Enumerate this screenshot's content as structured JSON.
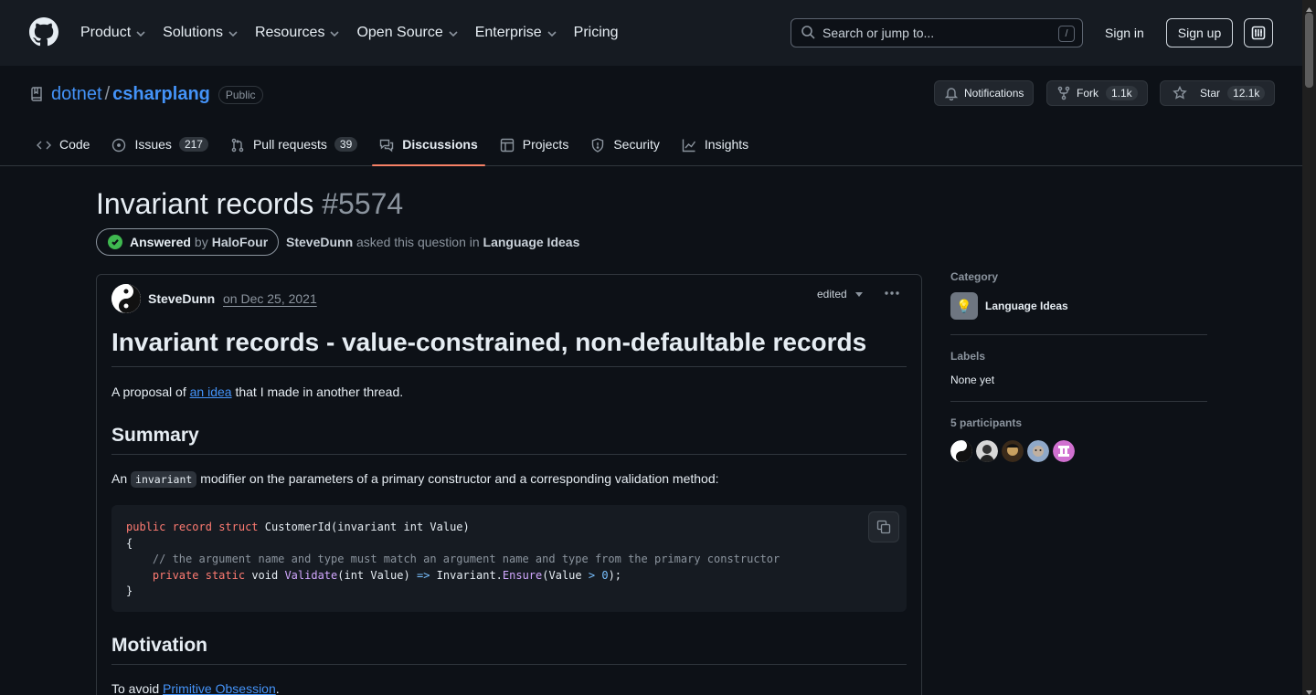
{
  "header": {
    "nav": [
      "Product",
      "Solutions",
      "Resources",
      "Open Source",
      "Enterprise",
      "Pricing"
    ],
    "search_placeholder": "Search or jump to...",
    "search_shortcut": "/",
    "sign_in": "Sign in",
    "sign_up": "Sign up"
  },
  "repo": {
    "owner": "dotnet",
    "separator": "/",
    "name": "csharplang",
    "visibility": "Public",
    "notifications": "Notifications",
    "fork_label": "Fork",
    "fork_count": "1.1k",
    "star_label": "Star",
    "star_count": "12.1k"
  },
  "tabs": [
    {
      "label": "Code",
      "icon": "code-icon"
    },
    {
      "label": "Issues",
      "count": "217",
      "icon": "issue-icon"
    },
    {
      "label": "Pull requests",
      "count": "39",
      "icon": "pull-request-icon"
    },
    {
      "label": "Discussions",
      "icon": "discussion-icon",
      "active": true
    },
    {
      "label": "Projects",
      "icon": "table-icon"
    },
    {
      "label": "Security",
      "icon": "shield-icon"
    },
    {
      "label": "Insights",
      "icon": "graph-icon"
    }
  ],
  "discussion": {
    "title": "Invariant records",
    "number": "#5574",
    "answered": "Answered",
    "by": "by",
    "answerer": "HaloFour",
    "asker": "SteveDunn",
    "asked_text": "asked this question in",
    "category": "Language Ideas"
  },
  "post": {
    "author": "SteveDunn",
    "date": "on Dec 25, 2021",
    "edited": "edited",
    "h1": "Invariant records - value-constrained, non-defaultable records",
    "intro_before": "A proposal of",
    "intro_link": "an idea",
    "intro_after": "that I made in another thread.",
    "summary_heading": "Summary",
    "summary_before": "An",
    "summary_code": "invariant",
    "summary_after": "modifier on the parameters of a primary constructor and a corresponding validation method:",
    "motivation_heading": "Motivation",
    "motivation_before": "To avoid",
    "motivation_link": "Primitive Obsession",
    "motivation_after": "."
  },
  "code": {
    "line1_kw1": "public",
    "line1_kw2": "record",
    "line1_kw3": "struct",
    "line1_rest": "CustomerId(invariant int Value)",
    "line2": "{",
    "line3_comment": "// the argument name and type must match an argument name and type from the primary constructor",
    "line4_kw1": "private",
    "line4_kw2": "static",
    "line4_void": "void",
    "line4_fn": "Validate",
    "line4_args": "(int Value)",
    "line4_arrow": "=>",
    "line4_obj": "Invariant.",
    "line4_fn2": "Ensure",
    "line4_open": "(Value",
    "line4_gt": ">",
    "line4_num": "0",
    "line4_close": ");",
    "line5": "}"
  },
  "sidebar": {
    "category_label": "Category",
    "category_emoji": "💡",
    "category_name": "Language Ideas",
    "labels_label": "Labels",
    "labels_value": "None yet",
    "participants_label": "5 participants"
  },
  "colors": {
    "accent_link": "#4493f8",
    "answered_green": "#3fb950",
    "active_tab_underline": "#f78166",
    "background": "#0d1117"
  }
}
